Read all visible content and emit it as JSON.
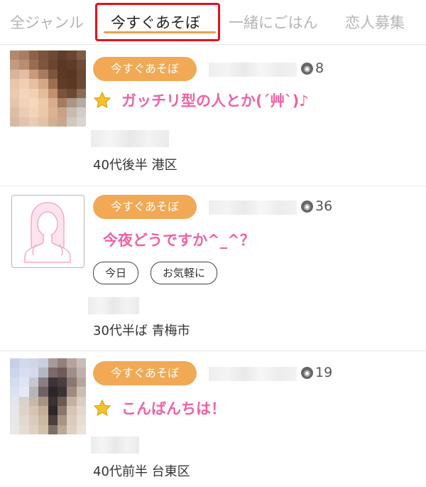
{
  "tabs": [
    {
      "label": "全ジャンル",
      "active": false
    },
    {
      "label": "今すぐあそぼ",
      "active": true
    },
    {
      "label": "一緒にごはん",
      "active": false
    },
    {
      "label": "恋人募集",
      "active": false
    }
  ],
  "colors": {
    "accent_badge": "#f1a955",
    "title_pink": "#f061a6",
    "tab_underline": "#f0a04a",
    "highlight_box": "#e8101b"
  },
  "posts": [
    {
      "badge": "今すぐあそぼ",
      "views": "8",
      "has_star": true,
      "title": "ガッチリ型の人とか(´艸`)♪",
      "tags": [],
      "meta": "40代後半 港区"
    },
    {
      "badge": "今すぐあそぼ",
      "views": "36",
      "has_star": false,
      "title": "今夜どうですか^_^？",
      "tags": [
        "今日",
        "お気軽に"
      ],
      "meta": "30代半ば 青梅市"
    },
    {
      "badge": "今すぐあそぼ",
      "views": "19",
      "has_star": true,
      "title": "こんばんちは！",
      "tags": [],
      "meta": "40代前半 台東区"
    }
  ],
  "icons": {
    "views": "eye-icon",
    "star": "star-icon",
    "avatar_placeholder": "person-silhouette-icon"
  }
}
